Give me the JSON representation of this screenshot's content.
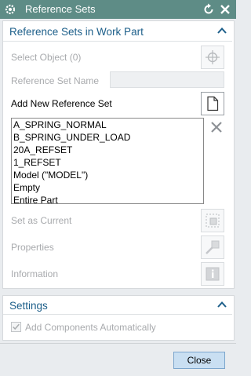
{
  "window": {
    "title": "Reference Sets"
  },
  "icons": {
    "app": "gear-icon",
    "reset": "reset-icon",
    "close": "close-x-icon"
  },
  "sections": {
    "work_part": {
      "title": "Reference Sets in Work Part"
    },
    "settings": {
      "title": "Settings"
    }
  },
  "fields": {
    "select_object": "Select Object (0)",
    "reference_set_name": "Reference Set Name",
    "reference_set_name_value": "",
    "add_new": "Add New Reference Set",
    "set_as_current": "Set as Current",
    "properties": "Properties",
    "information": "Information"
  },
  "list": {
    "items": [
      "A_SPRING_NORMAL",
      "B_SPRING_UNDER_LOAD",
      "20A_REFSET",
      "1_REFSET",
      "Model (\"MODEL\")",
      "Empty",
      "Entire Part"
    ]
  },
  "settings": {
    "add_components_label": "Add Components Automatically",
    "add_components_checked": true
  },
  "footer": {
    "close_label": "Close"
  },
  "colors": {
    "titlebar": "#5e8c86",
    "section_title": "#1d5f8a",
    "disabled_text": "#a8aaad",
    "close_button": "#c9dff2"
  }
}
